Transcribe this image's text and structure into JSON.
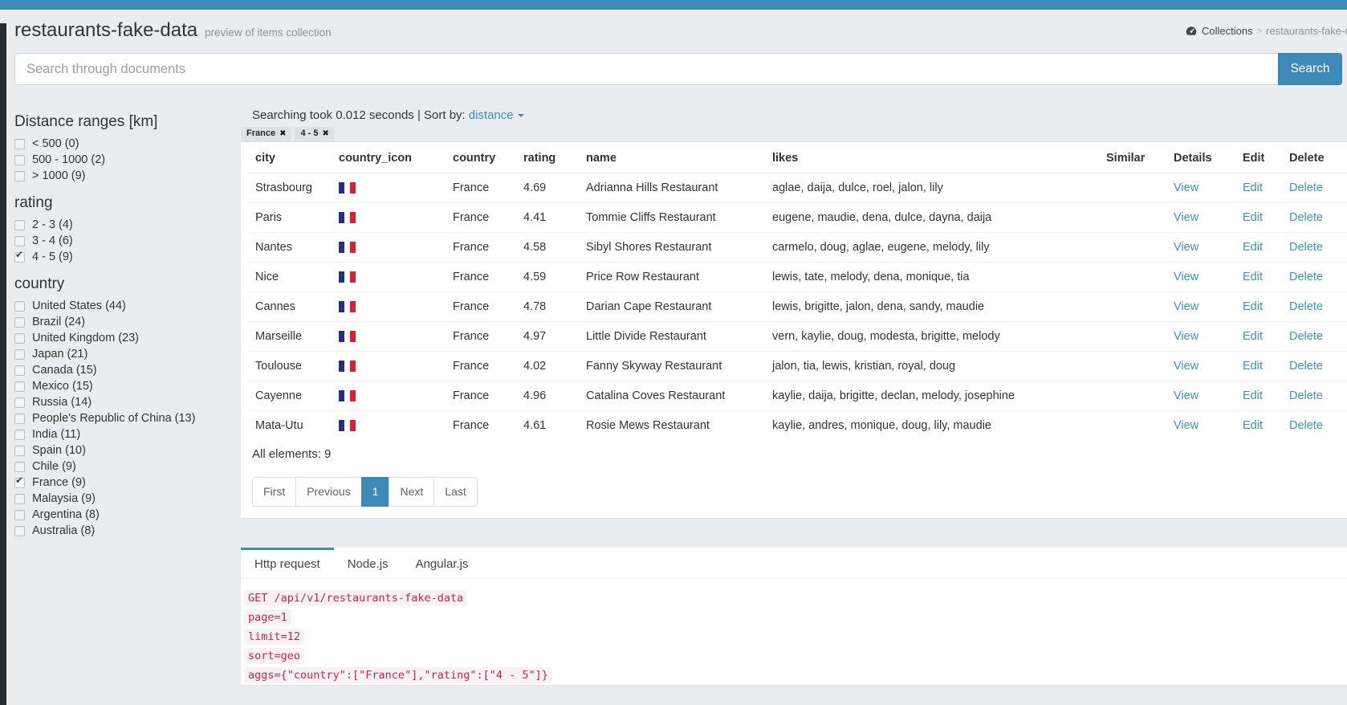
{
  "header": {
    "title": "restaurants-fake-data",
    "subtitle": "preview of items collection",
    "breadcrumb": {
      "root": "Collections",
      "separator": ">",
      "current": "restaurants-fake-data"
    }
  },
  "search": {
    "placeholder": "Search through documents",
    "button_label": "Search"
  },
  "facets": [
    {
      "title": "Distance ranges [km]",
      "items": [
        {
          "label": "< 500 (0)",
          "checked": false
        },
        {
          "label": "500 - 1000 (2)",
          "checked": false
        },
        {
          "label": "> 1000 (9)",
          "checked": false
        }
      ]
    },
    {
      "title": "rating",
      "items": [
        {
          "label": "2 - 3 (4)",
          "checked": false
        },
        {
          "label": "3 - 4 (6)",
          "checked": false
        },
        {
          "label": "4 - 5 (9)",
          "checked": true
        }
      ]
    },
    {
      "title": "country",
      "items": [
        {
          "label": "United States (44)",
          "checked": false
        },
        {
          "label": "Brazil (24)",
          "checked": false
        },
        {
          "label": "United Kingdom (23)",
          "checked": false
        },
        {
          "label": "Japan (21)",
          "checked": false
        },
        {
          "label": "Canada (15)",
          "checked": false
        },
        {
          "label": "Mexico (15)",
          "checked": false
        },
        {
          "label": "Russia (14)",
          "checked": false
        },
        {
          "label": "People's Republic of China (13)",
          "checked": false
        },
        {
          "label": "India (11)",
          "checked": false
        },
        {
          "label": "Spain (10)",
          "checked": false
        },
        {
          "label": "Chile (9)",
          "checked": false
        },
        {
          "label": "France (9)",
          "checked": true
        },
        {
          "label": "Malaysia (9)",
          "checked": false
        },
        {
          "label": "Argentina (8)",
          "checked": false
        },
        {
          "label": "Australia (8)",
          "checked": false
        }
      ]
    }
  ],
  "results": {
    "status_text": "Searching took 0.012 seconds | Sort by:",
    "sort_value": "distance",
    "active_filters": [
      {
        "label": "France"
      },
      {
        "label": "4 - 5"
      }
    ],
    "table": {
      "columns": [
        "city",
        "country_icon",
        "country",
        "rating",
        "name",
        "likes",
        "Similar",
        "Details",
        "Edit",
        "Delete"
      ],
      "row_links": {
        "details": "View",
        "edit": "Edit",
        "delete": "Delete"
      },
      "rows": [
        {
          "city": "Strasbourg",
          "country": "France",
          "rating": "4.69",
          "name": "Adrianna Hills Restaurant",
          "likes": "aglae, daija, dulce, roel, jalon, lily"
        },
        {
          "city": "Paris",
          "country": "France",
          "rating": "4.41",
          "name": "Tommie Cliffs Restaurant",
          "likes": "eugene, maudie, dena, dulce, dayna, daija"
        },
        {
          "city": "Nantes",
          "country": "France",
          "rating": "4.58",
          "name": "Sibyl Shores Restaurant",
          "likes": "carmelo, doug, aglae, eugene, melody, lily"
        },
        {
          "city": "Nice",
          "country": "France",
          "rating": "4.59",
          "name": "Price Row Restaurant",
          "likes": "lewis, tate, melody, dena, monique, tia"
        },
        {
          "city": "Cannes",
          "country": "France",
          "rating": "4.78",
          "name": "Darian Cape Restaurant",
          "likes": "lewis, brigitte, jalon, dena, sandy, maudie"
        },
        {
          "city": "Marseille",
          "country": "France",
          "rating": "4.97",
          "name": "Little Divide Restaurant",
          "likes": "vern, kaylie, doug, modesta, brigitte, melody"
        },
        {
          "city": "Toulouse",
          "country": "France",
          "rating": "4.02",
          "name": "Fanny Skyway Restaurant",
          "likes": "jalon, tia, lewis, kristian, royal, doug"
        },
        {
          "city": "Cayenne",
          "country": "France",
          "rating": "4.96",
          "name": "Catalina Coves Restaurant",
          "likes": "kaylie, daija, brigitte, declan, melody, josephine"
        },
        {
          "city": "Mata-Utu",
          "country": "France",
          "rating": "4.61",
          "name": "Rosie Mews Restaurant",
          "likes": "kaylie, andres, monique, doug, lily, maudie"
        }
      ]
    },
    "summary": "All elements: 9",
    "pagination": [
      {
        "label": "First"
      },
      {
        "label": "Previous"
      },
      {
        "label": "1",
        "active": true
      },
      {
        "label": "Next"
      },
      {
        "label": "Last"
      }
    ]
  },
  "request_panel": {
    "tabs": [
      {
        "label": "Http request",
        "active": true
      },
      {
        "label": "Node.js",
        "active": false
      },
      {
        "label": "Angular.js",
        "active": false
      }
    ],
    "code_lines": [
      "GET /api/v1/restaurants-fake-data",
      "page=1",
      "limit=12",
      "sort=geo",
      "aggs={\"country\":[\"France\"],\"rating\":[\"4 - 5\"]}"
    ]
  },
  "icons": {
    "dashboard-icon": "tachometer-gauge",
    "check-icon": "✔",
    "remove-icon": "✖",
    "caret-down-icon": "▾",
    "france-flag-icon": "vertical tricolor blue-white-red"
  },
  "colors": {
    "accent": "#3d8ab8",
    "topbar": "#3d8ab8",
    "page_background": "#e9edf1",
    "nav_strip": "#252b33",
    "link": "#4190bd",
    "code_text": "#c7254e",
    "code_background": "#f9f2f4",
    "flag_blue": "#22317e",
    "flag_white": "#ffffff",
    "flag_red": "#d8222f"
  }
}
